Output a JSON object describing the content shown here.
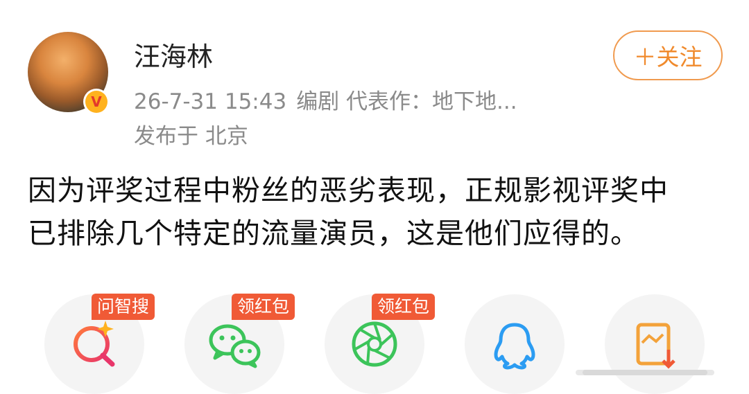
{
  "user": {
    "name": "汪海林",
    "verified_badge": "V",
    "meta_date": "26-7-31 15:43",
    "meta_title": "编剧 代表作：地下地...",
    "location": "发布于 北京"
  },
  "follow_button": {
    "label": "＋关注",
    "color": "#f08a2c"
  },
  "post": {
    "line1": "因为评奖过程中粉丝的恶劣表现，正规影视评奖中",
    "line2": "已排除几个特定的流量演员，这是他们应得的。"
  },
  "share_options": [
    {
      "icon": "ai-search-icon",
      "badge": "问智搜"
    },
    {
      "icon": "wechat-icon",
      "badge": "领红包"
    },
    {
      "icon": "moments-icon",
      "badge": "领红包"
    },
    {
      "icon": "qq-icon",
      "badge": ""
    },
    {
      "icon": "save-image-icon",
      "badge": ""
    }
  ],
  "colors": {
    "badge": "#f05a36",
    "follow_border": "#f09a4e",
    "meta_gray": "#8a8a8a"
  }
}
